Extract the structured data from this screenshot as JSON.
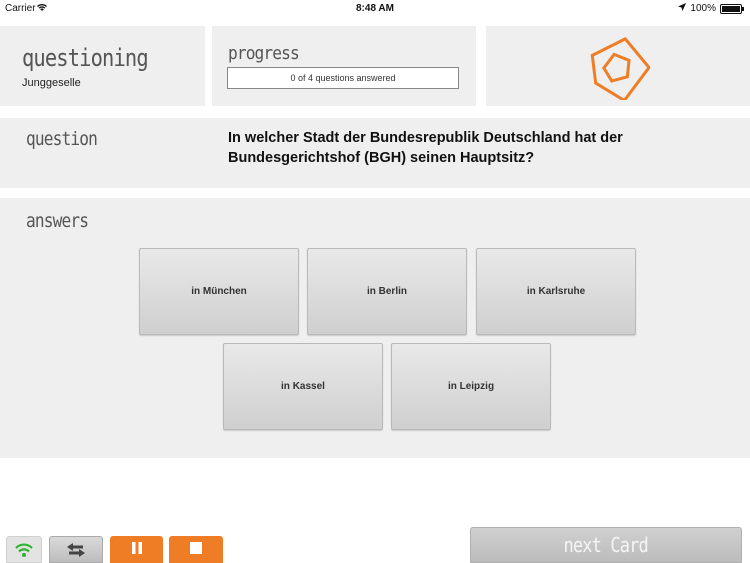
{
  "status_bar": {
    "carrier": "Carrier",
    "time": "8:48 AM",
    "battery": "100%"
  },
  "questioning": {
    "heading": "questioning",
    "category": "Junggeselle"
  },
  "progress": {
    "heading": "progress",
    "text": "0 of 4 questions answered",
    "answered": 0,
    "total": 4
  },
  "question": {
    "heading": "question",
    "text": "In welcher Stadt der Bundesrepublik Deutschland hat der Bundesgerichtshof (BGH) seinen Hauptsitz?"
  },
  "answers": {
    "heading": "answers",
    "options": [
      "in München",
      "in Berlin",
      "in Karlsruhe",
      "in Kassel",
      "in Leipzig"
    ]
  },
  "toolbar": {
    "wifi_icon": "wifi-icon",
    "swap_icon": "swap-arrows-icon",
    "pause_icon": "pause-icon",
    "stop_icon": "stop-icon",
    "next_label": "next Card"
  },
  "colors": {
    "accent": "#ef7d25",
    "panel": "#efefef",
    "wifi": "#2db52d"
  }
}
